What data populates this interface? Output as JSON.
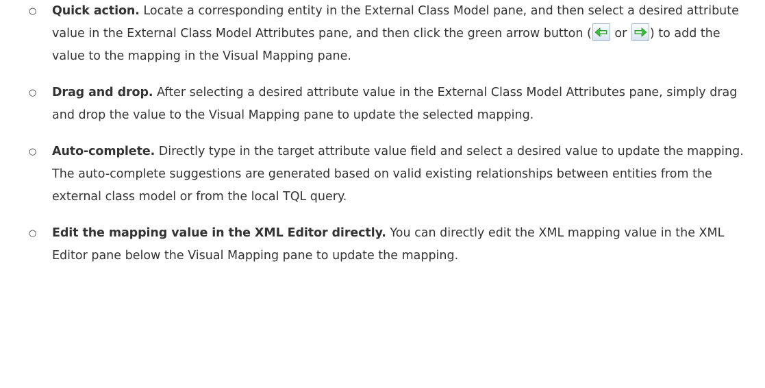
{
  "bullet_marker": "○",
  "items": [
    {
      "lead": "Quick action.",
      "text_1": " Locate a corresponding entity in the External Class Model pane, and then select a desired attribute value in the External Class Model Attributes pane, and then click the green arrow button (",
      "icon_1": "left-arrow-icon",
      "text_2": " or ",
      "icon_2": "right-arrow-icon",
      "text_3": ") to add the value to the mapping in the Visual Mapping pane."
    },
    {
      "lead": "Drag and drop.",
      "text": " After selecting a desired attribute value in the External Class Model Attributes pane, simply drag and drop the value to the Visual Mapping pane to update the selected mapping."
    },
    {
      "lead": "Auto-complete.",
      "text": " Directly type in the target attribute value field and select a desired value to update the mapping. The auto-complete suggestions are generated based on valid existing relationships between entities from the external class model or from the local TQL query."
    },
    {
      "lead": "Edit the mapping value in the XML Editor directly.",
      "text": " You can directly edit the XML mapping value in the XML Editor pane below the Visual Mapping pane to update the mapping."
    }
  ],
  "colors": {
    "text": "#333333",
    "arrow_green": "#3cbf3c",
    "button_border": "#a8b8c8"
  }
}
